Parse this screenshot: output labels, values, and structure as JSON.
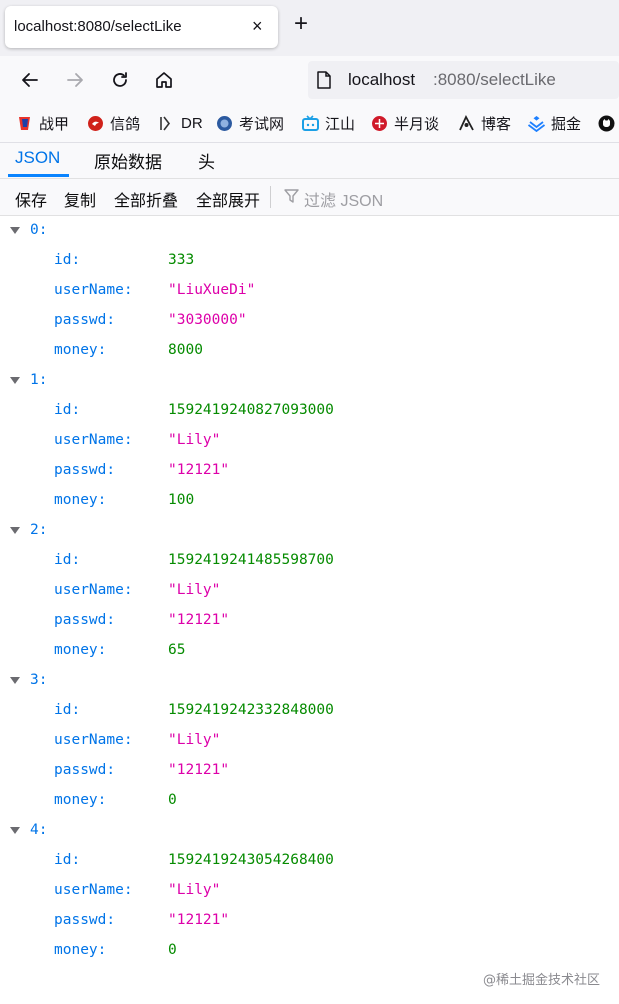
{
  "browser": {
    "tab_title": "localhost:8080/selectLike",
    "close_glyph": "×",
    "new_tab_glyph": "+",
    "url_host": "localhost",
    "url_rest": ":8080/selectLike"
  },
  "bookmarks": [
    {
      "label": "战甲",
      "icon": "shield-icon",
      "color": "#e8332a"
    },
    {
      "label": "信鸽",
      "icon": "pigeon-icon",
      "color": "#d0211a"
    },
    {
      "label": "DR",
      "icon": "dr-icon",
      "color": "#333333"
    },
    {
      "label": "考试网",
      "icon": "globe-icon",
      "color": "#2c5aa0"
    },
    {
      "label": "江山",
      "icon": "tv-icon",
      "color": "#1ca0e6"
    },
    {
      "label": "半月谈",
      "icon": "circle-icon",
      "color": "#d01a2a"
    },
    {
      "label": "博客",
      "icon": "pen-icon",
      "color": "#222222"
    },
    {
      "label": "掘金",
      "icon": "juejin-icon",
      "color": "#1e80ff"
    }
  ],
  "viewer": {
    "tabs": [
      "JSON",
      "原始数据",
      "头"
    ],
    "toolbar": [
      "保存",
      "复制",
      "全部折叠",
      "全部展开"
    ],
    "filter_placeholder": "过滤 JSON"
  },
  "records": [
    {
      "index": "0:",
      "id": "333",
      "userName": "\"LiuXueDi\"",
      "passwd": "\"3030000\"",
      "money": "8000"
    },
    {
      "index": "1:",
      "id": "1592419240827093000",
      "userName": "\"Lily\"",
      "passwd": "\"12121\"",
      "money": "100"
    },
    {
      "index": "2:",
      "id": "1592419241485598700",
      "userName": "\"Lily\"",
      "passwd": "\"12121\"",
      "money": "65"
    },
    {
      "index": "3:",
      "id": "1592419242332848000",
      "userName": "\"Lily\"",
      "passwd": "\"12121\"",
      "money": "0"
    },
    {
      "index": "4:",
      "id": "1592419243054268400",
      "userName": "\"Lily\"",
      "passwd": "\"12121\"",
      "money": "0"
    }
  ],
  "field_labels": {
    "id": "id:",
    "userName": "userName:",
    "passwd": "passwd:",
    "money": "money:"
  },
  "watermark": "@稀土掘金技术社区"
}
